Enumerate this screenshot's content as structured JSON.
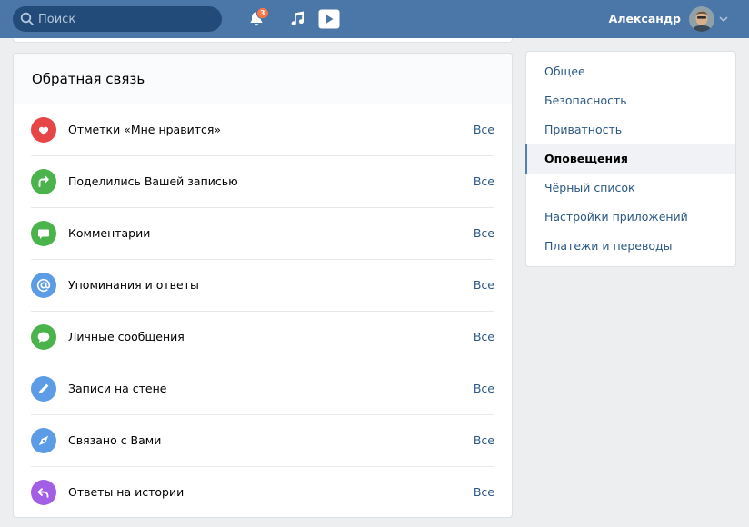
{
  "header": {
    "search_placeholder": "Поиск",
    "search_icon": "search-icon",
    "notifications": {
      "icon": "bell-icon",
      "count": "3"
    },
    "music_icon": "music-note-icon",
    "video_icon": "video-play-icon",
    "user_name": "Александр",
    "avatar": "avatar",
    "menu_icon": "chevron-down-icon"
  },
  "feedback": {
    "title": "Обратная связь",
    "items": [
      {
        "label": "Отметки «Мне нравится»",
        "action": "Все",
        "icon": "heart-icon",
        "color": "#e64646"
      },
      {
        "label": "Поделились Вашей записью",
        "action": "Все",
        "icon": "share-icon",
        "color": "#4bb34b"
      },
      {
        "label": "Комментарии",
        "action": "Все",
        "icon": "comment-icon",
        "color": "#4bb34b"
      },
      {
        "label": "Упоминания и ответы",
        "action": "Все",
        "icon": "mention-icon",
        "color": "#5c9ce6"
      },
      {
        "label": "Личные сообщения",
        "action": "Все",
        "icon": "message-icon",
        "color": "#4bb34b"
      },
      {
        "label": "Записи на стене",
        "action": "Все",
        "icon": "pencil-icon",
        "color": "#5c9ce6"
      },
      {
        "label": "Связано с Вами",
        "action": "Все",
        "icon": "compass-icon",
        "color": "#5c9ce6"
      },
      {
        "label": "Ответы на истории",
        "action": "Все",
        "icon": "reply-icon",
        "color": "#a35ee6"
      }
    ]
  },
  "settings_menu": {
    "items": [
      {
        "label": "Общее",
        "active": false
      },
      {
        "label": "Безопасность",
        "active": false
      },
      {
        "label": "Приватность",
        "active": false
      },
      {
        "label": "Оповещения",
        "active": true
      },
      {
        "label": "Чёрный список",
        "active": false
      },
      {
        "label": "Настройки приложений",
        "active": false
      },
      {
        "label": "Платежи и переводы",
        "active": false
      }
    ]
  },
  "colors": {
    "header": "#4a76a8",
    "search": "#224b7a",
    "link": "#2a5885",
    "background": "#edeef0",
    "badge": "#ff7443",
    "active_marker": "#5181b8"
  }
}
